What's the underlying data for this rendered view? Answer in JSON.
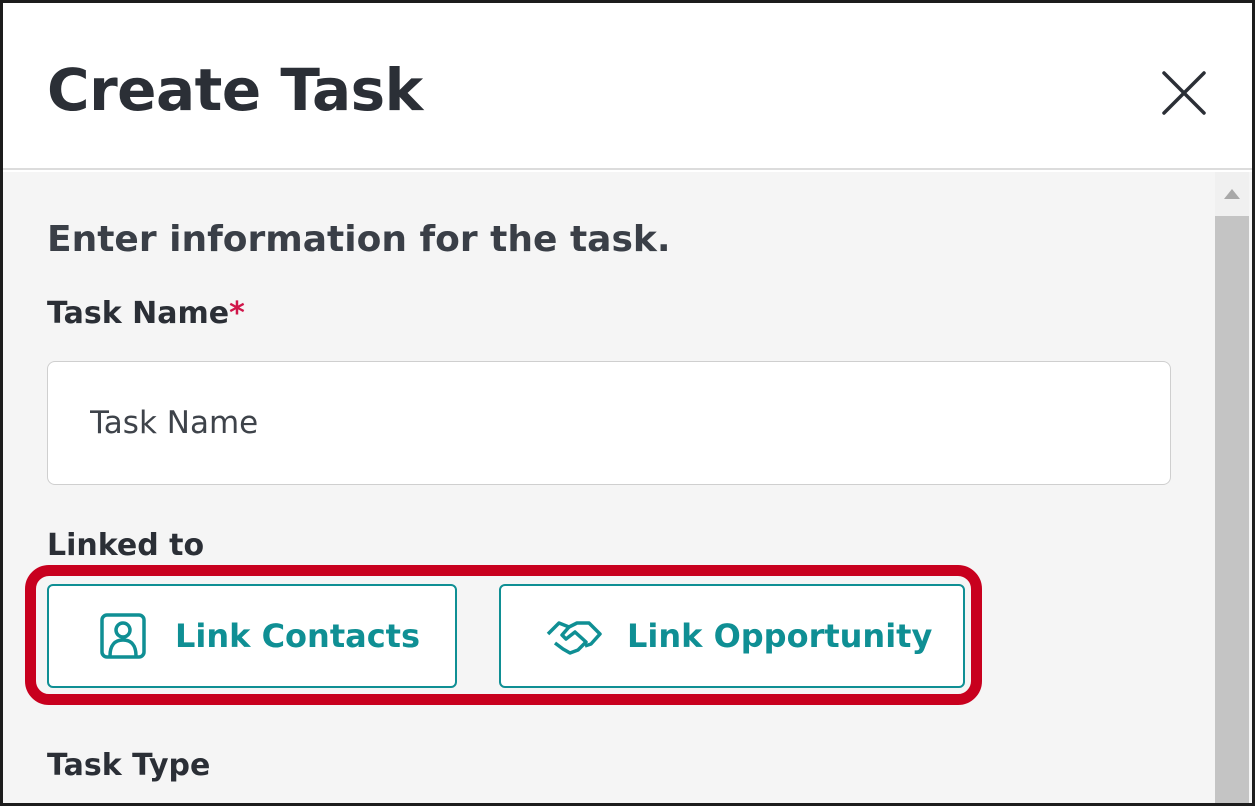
{
  "dialog": {
    "title": "Create Task",
    "close_icon": "close-icon"
  },
  "form": {
    "intro": "Enter information for the task.",
    "task_name": {
      "label": "Task Name",
      "required_marker": "*",
      "placeholder": "Task Name",
      "value": ""
    },
    "linked_to": {
      "label": "Linked to",
      "buttons": [
        {
          "label": "Link Contacts",
          "icon": "contact-icon"
        },
        {
          "label": "Link Opportunity",
          "icon": "handshake-icon"
        }
      ]
    },
    "task_type": {
      "label": "Task Type"
    }
  },
  "colors": {
    "accent": "#0f8f94",
    "highlight": "#c8001e",
    "required": "#d0164a",
    "title_text": "#2b2f36",
    "body_background": "#f5f5f5"
  }
}
